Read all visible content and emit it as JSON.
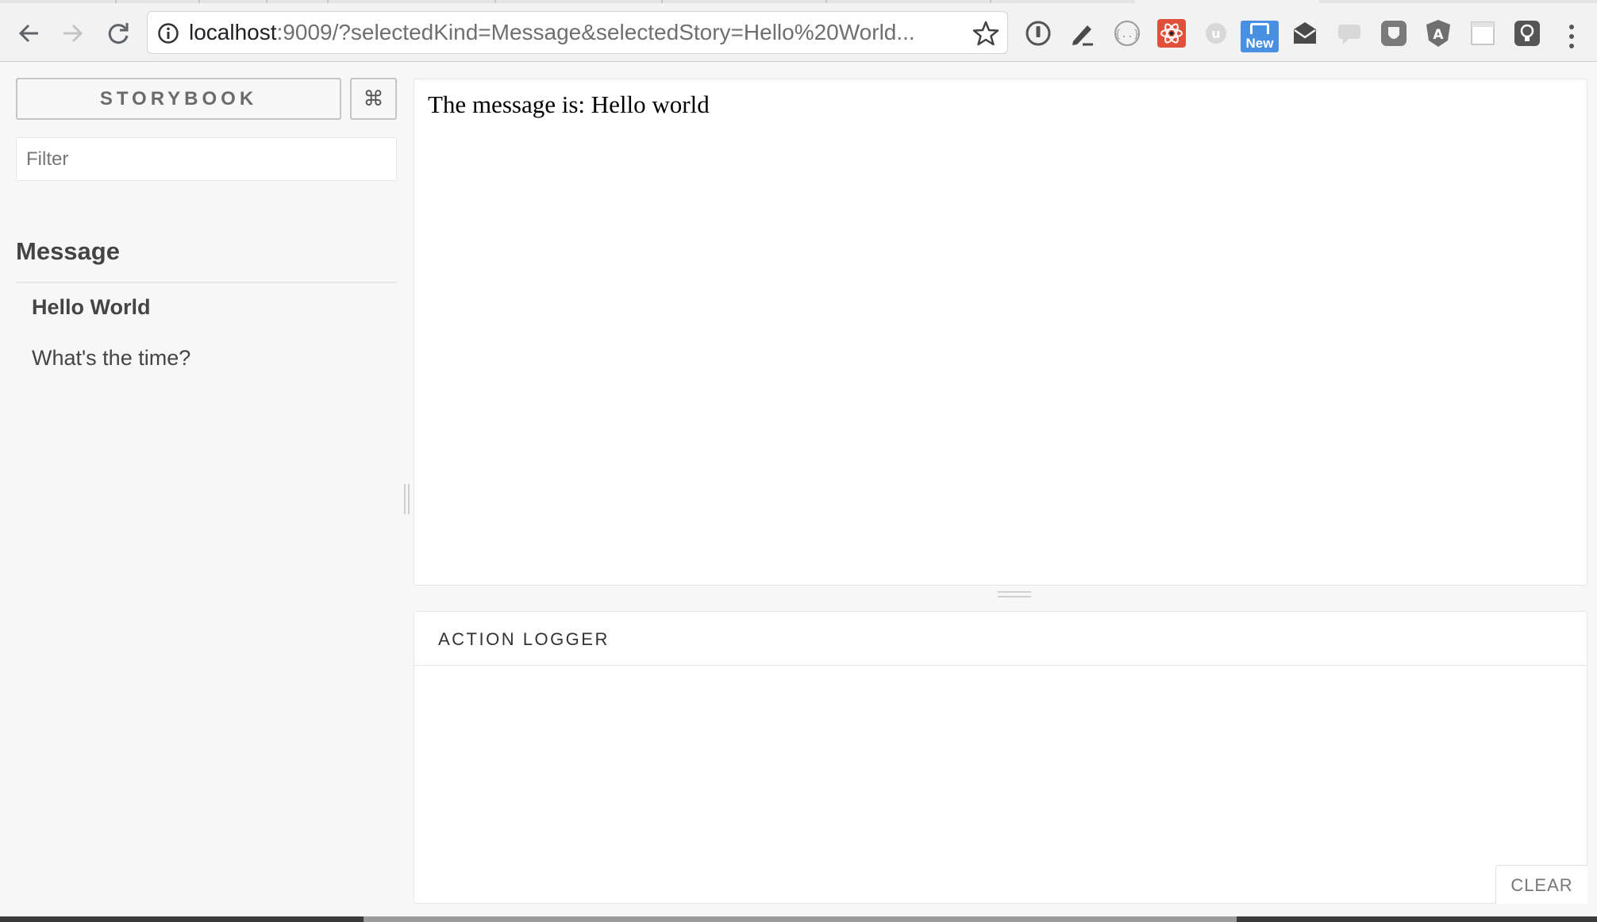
{
  "browser": {
    "url_host": "localhost",
    "url_rest": ":9009/?selectedKind=Message&selectedStory=Hello%20World...",
    "extensions": {
      "new_badge": "New"
    }
  },
  "sidebar": {
    "storybook_label": "STORYBOOK",
    "shortcut_label": "⌘",
    "filter_placeholder": "Filter",
    "kind": "Message",
    "stories": [
      {
        "label": "Hello World",
        "selected": true
      },
      {
        "label": "What's the time?",
        "selected": false
      }
    ]
  },
  "preview": {
    "text": "The message is: Hello world"
  },
  "addon_panel": {
    "tab_label": "ACTION LOGGER",
    "clear_label": "CLEAR"
  },
  "colors": {
    "background": "#f7f7f7",
    "panel": "#ffffff",
    "new_badge": "#4a90e2",
    "react_ext": "#e0503a"
  }
}
